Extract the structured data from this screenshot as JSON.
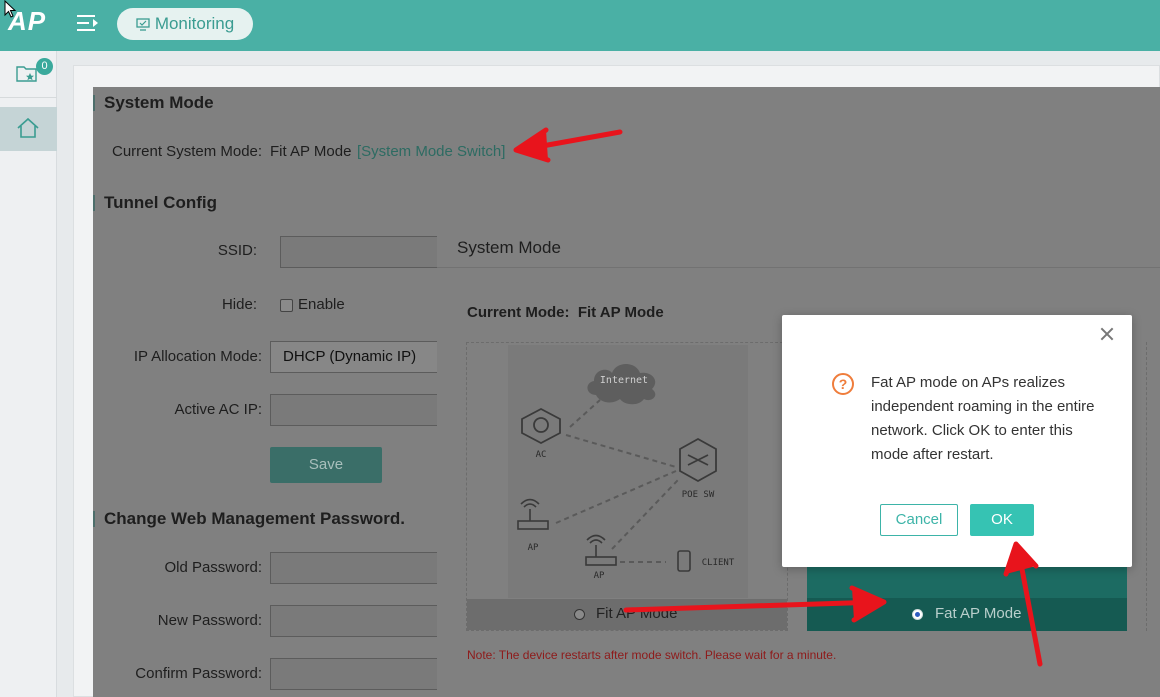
{
  "app": {
    "logo": "AP",
    "nav_monitoring": "Monitoring"
  },
  "sidebar": {
    "favorites_badge": "0"
  },
  "system_mode": {
    "title": "System Mode",
    "current_label": "Current System Mode:",
    "current_value": "Fit AP Mode",
    "switch_link": "[System Mode Switch]"
  },
  "tunnel": {
    "title": "Tunnel Config",
    "ssid_label": "SSID:",
    "hide_label": "Hide:",
    "enable_label": "Enable",
    "ip_alloc_label": "IP Allocation Mode:",
    "ip_alloc_value": "DHCP (Dynamic IP)",
    "ac_ip_label": "Active AC IP:",
    "save_label": "Save"
  },
  "password": {
    "title": "Change Web Management Password.",
    "old_label": "Old Password:",
    "new_label": "New Password:",
    "confirm_label": "Confirm Password:"
  },
  "modal": {
    "title": "System Mode",
    "current_mode_label": "Current Mode:",
    "current_mode_value": "Fit AP Mode",
    "diagram_labels": {
      "internet": "Internet",
      "ac": "AC",
      "poe": "POE SW",
      "ap1": "AP",
      "ap2": "AP",
      "client": "CLIENT"
    },
    "fit_option": "Fit AP Mode",
    "fat_option": "Fat AP Mode",
    "note": "Note: The device restarts after mode switch. Please wait for a minute."
  },
  "confirm": {
    "message": "Fat AP mode on APs realizes independent roaming in the entire network. Click OK to enter this mode after restart.",
    "cancel_label": "Cancel",
    "ok_label": "OK"
  },
  "colors": {
    "topbar": "#4ab0a5",
    "accent": "#36c3b3",
    "annotation": "#e8141c",
    "warning": "#ef7d3c"
  }
}
